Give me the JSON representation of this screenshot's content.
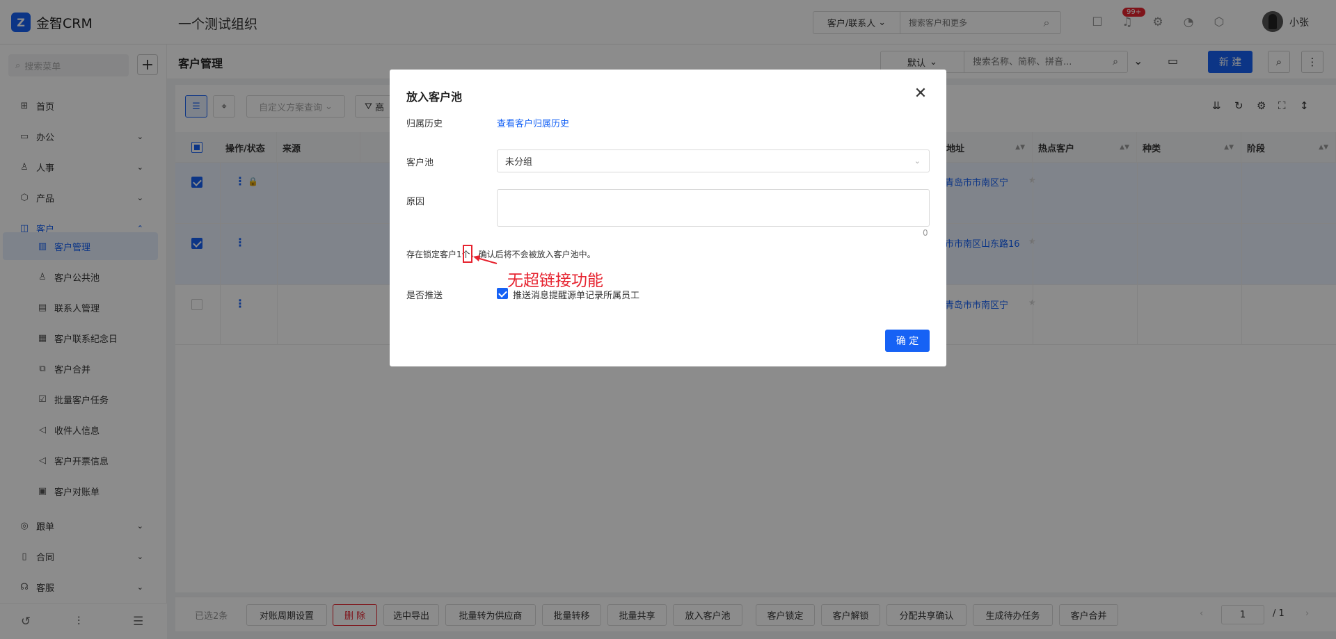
{
  "app": {
    "brand": "金智CRM",
    "org_name": "一个测试组织",
    "user_name": "小张",
    "notification_badge": "99+"
  },
  "global_search": {
    "type": "客户/联系人",
    "placeholder": "搜索客户和更多"
  },
  "sidebar": {
    "search_placeholder": "搜索菜单",
    "items": [
      {
        "label": "首页",
        "icon": "home-icon"
      },
      {
        "label": "办公",
        "icon": "office-icon"
      },
      {
        "label": "人事",
        "icon": "people-icon"
      },
      {
        "label": "产品",
        "icon": "product-icon"
      },
      {
        "label": "客户",
        "icon": "customer-icon"
      }
    ],
    "sub_items": [
      "客户管理",
      "客户公共池",
      "联系人管理",
      "客户联系纪念日",
      "客户合并",
      "批量客户任务",
      "收件人信息",
      "客户开票信息",
      "客户对账单"
    ],
    "items_after": [
      {
        "label": "跟单",
        "icon": "follow-icon"
      },
      {
        "label": "合同",
        "icon": "contract-icon"
      },
      {
        "label": "客服",
        "icon": "service-icon"
      }
    ]
  },
  "page": {
    "title": "客户管理",
    "view_select": "默认",
    "view_search_placeholder": "搜索名称、简称、拼音...",
    "new_button": "新 建",
    "custom_query_placeholder": "自定义方案查询",
    "advanced_filter": "高"
  },
  "table": {
    "columns": [
      "操作/状态",
      "来源",
      "地址",
      "热点客户",
      "种类",
      "阶段"
    ],
    "rows": [
      {
        "address": "青岛市市南区宁"
      },
      {
        "address": "市市南区山东路16"
      },
      {
        "address": "青岛市市南区宁"
      }
    ]
  },
  "bottom_bar": {
    "selected_count": "已选2条",
    "buttons": [
      "对账周期设置",
      "删 除",
      "选中导出",
      "批量转为供应商",
      "批量转移",
      "批量共享",
      "放入客户池",
      "客户锁定",
      "客户解锁",
      "分配共享确认",
      "生成待办任务",
      "客户合并"
    ],
    "page_current": "1",
    "page_total": "/ 1"
  },
  "modal": {
    "title": "放入客户池",
    "history_label": "归属历史",
    "history_link": "查看客户归属历史",
    "pool_label": "客户池",
    "pool_value": "未分组",
    "reason_label": "原因",
    "reason_count": "0",
    "notice": "存在锁定客户1个，确认后将不会被放入客户池中。",
    "annotation": "无超链接功能",
    "push_label": "是否推送",
    "push_option": "推送消息提醒源单记录所属员工",
    "confirm": "确 定"
  },
  "colors": {
    "primary": "#1662f5",
    "danger": "#e6232f"
  }
}
